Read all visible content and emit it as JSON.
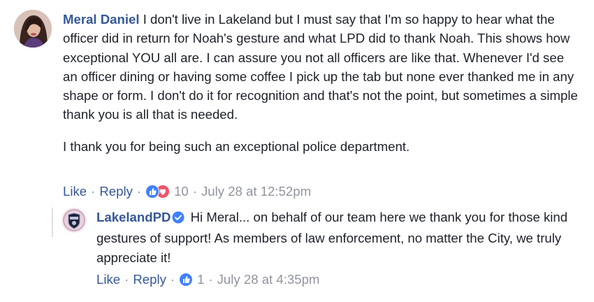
{
  "comment": {
    "author": "Meral Daniel",
    "text_p1": "I don't live in Lakeland but I must say that I'm so happy to hear what the officer did in return for Noah's gesture and what LPD did to thank Noah. This shows how exceptional YOU all are. I can assure you not all officers are like that. Whenever I'd see an officer dining or having some coffee I pick up the tab but none ever thanked me in any shape or form. I don't do it for recognition and that's not the point, but sometimes a simple thank you is all that is needed.",
    "text_p2": "I thank you for being such an exceptional police department.",
    "like_label": "Like",
    "reply_label": "Reply",
    "reaction_count": "10",
    "timestamp": "July 28 at 12:52pm",
    "reactions": [
      "like-icon",
      "love-icon"
    ]
  },
  "reply": {
    "author": "LakelandPD",
    "verified": true,
    "text": "Hi Meral... on behalf of our team here we thank you for those kind gestures of support! As members of law enforcement, no matter the City, we truly appreciate it!",
    "like_label": "Like",
    "reply_label": "Reply",
    "reaction_count": "1",
    "timestamp": "July 28 at 4:35pm",
    "reactions": [
      "like-icon"
    ]
  },
  "colors": {
    "author_link": "#365899",
    "meta_text": "#90949c",
    "like_blue": "#4080ff",
    "love_red": "#f25268",
    "verified_blue": "#4080ff"
  },
  "separator_dot": "·"
}
